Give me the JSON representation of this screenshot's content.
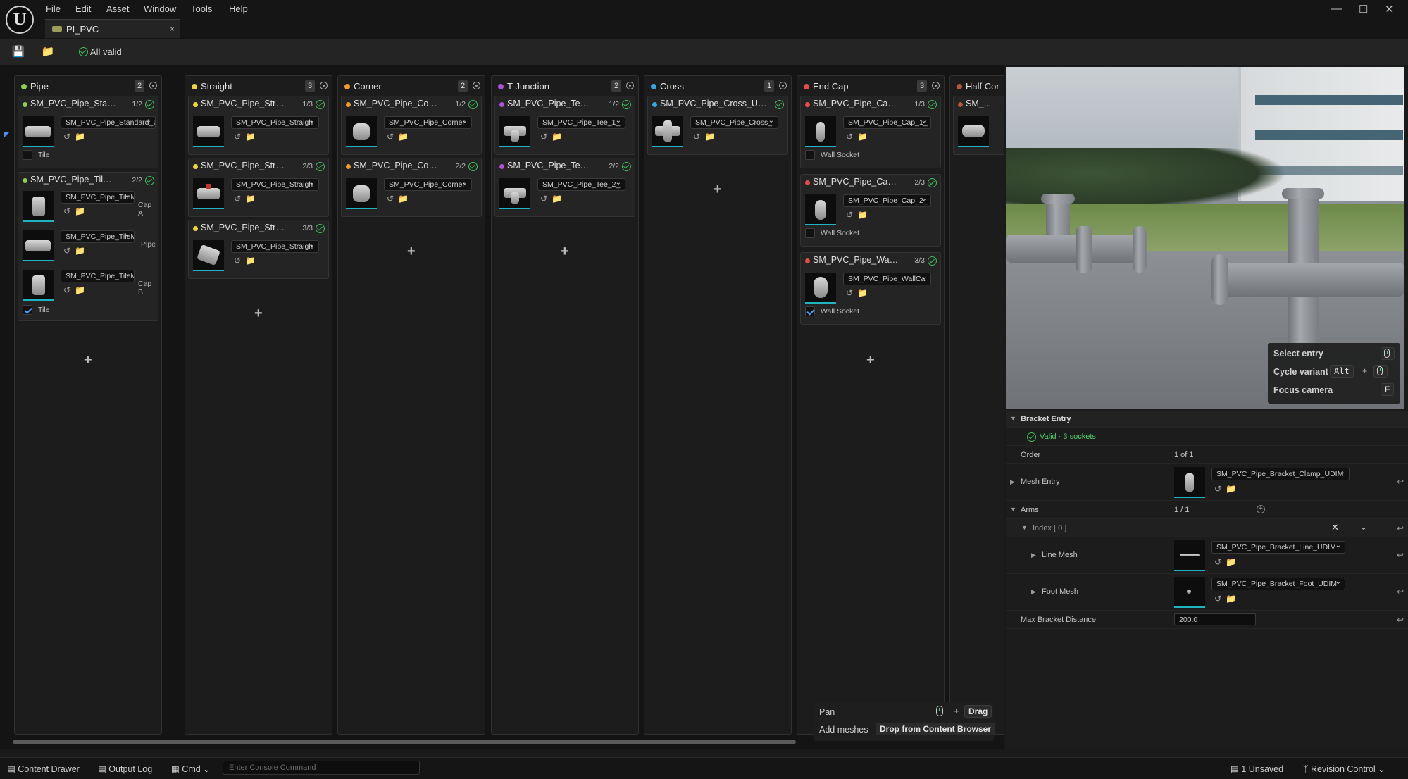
{
  "menu": [
    "File",
    "Edit",
    "Asset",
    "Window",
    "Tools",
    "Help"
  ],
  "tab": {
    "title": "PI_PVC",
    "close": "×"
  },
  "window_controls": {
    "minimize": "—",
    "maximize": "☐",
    "close": "✕"
  },
  "toolbar": {
    "status": "All valid"
  },
  "columns": [
    {
      "title": "Pipe",
      "count": "2",
      "color": "#8fd14f"
    },
    {
      "title": "Straight",
      "count": "3",
      "color": "#f1d43a"
    },
    {
      "title": "Corner",
      "count": "2",
      "color": "#f29a2e"
    },
    {
      "title": "T-Junction",
      "count": "2",
      "color": "#b14fd6"
    },
    {
      "title": "Cross",
      "count": "1",
      "color": "#2fa8e8"
    },
    {
      "title": "End Cap",
      "count": "3",
      "color": "#e84a4a"
    },
    {
      "title": "Half Cor",
      "count": "",
      "color": "#b3573a"
    }
  ],
  "cards": {
    "pipe1": {
      "title": "SM_PVC_Pipe_Standard_U...",
      "idx": "1/2",
      "dd": "SM_PVC_Pipe_Standard_U",
      "cb": "Tile"
    },
    "pipe2": {
      "title": "SM_PVC_Pipe_TileMesh_U...",
      "idx": "2/2",
      "dd1": "SM_PVC_Pipe_TileM",
      "lbl1": "Cap A",
      "dd2": "SM_PVC_Pipe_TileMe",
      "lbl2": "Pipe",
      "dd3": "SM_PVC_Pipe_TileM",
      "lbl3": "Cap B",
      "cb": "Tile"
    },
    "str1": {
      "title": "SM_PVC_Pipe_Straigh...",
      "idx": "1/3",
      "dd": "SM_PVC_Pipe_Straigh"
    },
    "str2": {
      "title": "SM_PVC_Pipe_Straigh...",
      "idx": "2/3",
      "dd": "SM_PVC_Pipe_Straigh"
    },
    "str3": {
      "title": "SM_PVC_Pipe_Straigh...",
      "idx": "3/3",
      "dd": "SM_PVC_Pipe_Straigh"
    },
    "cor1": {
      "title": "SM_PVC_Pipe_Corner_...",
      "idx": "1/2",
      "dd": "SM_PVC_Pipe_Corner"
    },
    "cor2": {
      "title": "SM_PVC_Pipe_Corner_...",
      "idx": "2/2",
      "dd": "SM_PVC_Pipe_Corner"
    },
    "tee1": {
      "title": "SM_PVC_Pipe_Tee_1_...",
      "idx": "1/2",
      "dd": "SM_PVC_Pipe_Tee_1_"
    },
    "tee2": {
      "title": "SM_PVC_Pipe_Tee_2_...",
      "idx": "2/2",
      "dd": "SM_PVC_Pipe_Tee_2_"
    },
    "cross1": {
      "title": "SM_PVC_Pipe_Cross_UDIM",
      "idx": "",
      "dd": "SM_PVC_Pipe_Cross_"
    },
    "cap1": {
      "title": "SM_PVC_Pipe_Cap_1_...",
      "idx": "1/3",
      "dd": "SM_PVC_Pipe_Cap_1_",
      "cb": "Wall Socket"
    },
    "cap2": {
      "title": "SM_PVC_Pipe_Cap_2_...",
      "idx": "2/3",
      "dd": "SM_PVC_Pipe_Cap_2_",
      "cb": "Wall Socket"
    },
    "cap3": {
      "title": "SM_PVC_Pipe_WallCa...",
      "idx": "3/3",
      "dd": "SM_PVC_Pipe_WallCa",
      "cb": "Wall Socket"
    },
    "half1": {
      "title": "SM_..."
    }
  },
  "board_hints": {
    "pan": "Pan",
    "pan_key": "Drag",
    "add": "Add meshes",
    "add_key": "Drop from Content Browser",
    "plus": "+"
  },
  "viewport_hints": {
    "select": "Select entry",
    "cycle": "Cycle variant",
    "cycle_key": "Alt",
    "focus": "Focus camera",
    "focus_key": "F",
    "plus": "+"
  },
  "details": {
    "section": "Bracket Entry",
    "valid": "Valid · 3 sockets",
    "order_label": "Order",
    "order_value": "1 of 1",
    "mesh_entry_label": "Mesh Entry",
    "mesh_entry_value": "SM_PVC_Pipe_Bracket_Clamp_UDIM",
    "arms_label": "Arms",
    "arms_value": "1 / 1",
    "index_label": "Index [ 0 ]",
    "line_mesh_label": "Line Mesh",
    "line_mesh_value": "SM_PVC_Pipe_Bracket_Line_UDIM",
    "foot_mesh_label": "Foot Mesh",
    "foot_mesh_value": "SM_PVC_Pipe_Bracket_Foot_UDIM",
    "max_dist_label": "Max Bracket Distance",
    "max_dist_value": "200.0"
  },
  "bottom": {
    "content_drawer": "Content Drawer",
    "output_log": "Output Log",
    "cmd": "Cmd",
    "console_placeholder": "Enter Console Command",
    "unsaved": "1 Unsaved",
    "revision": "Revision Control"
  }
}
